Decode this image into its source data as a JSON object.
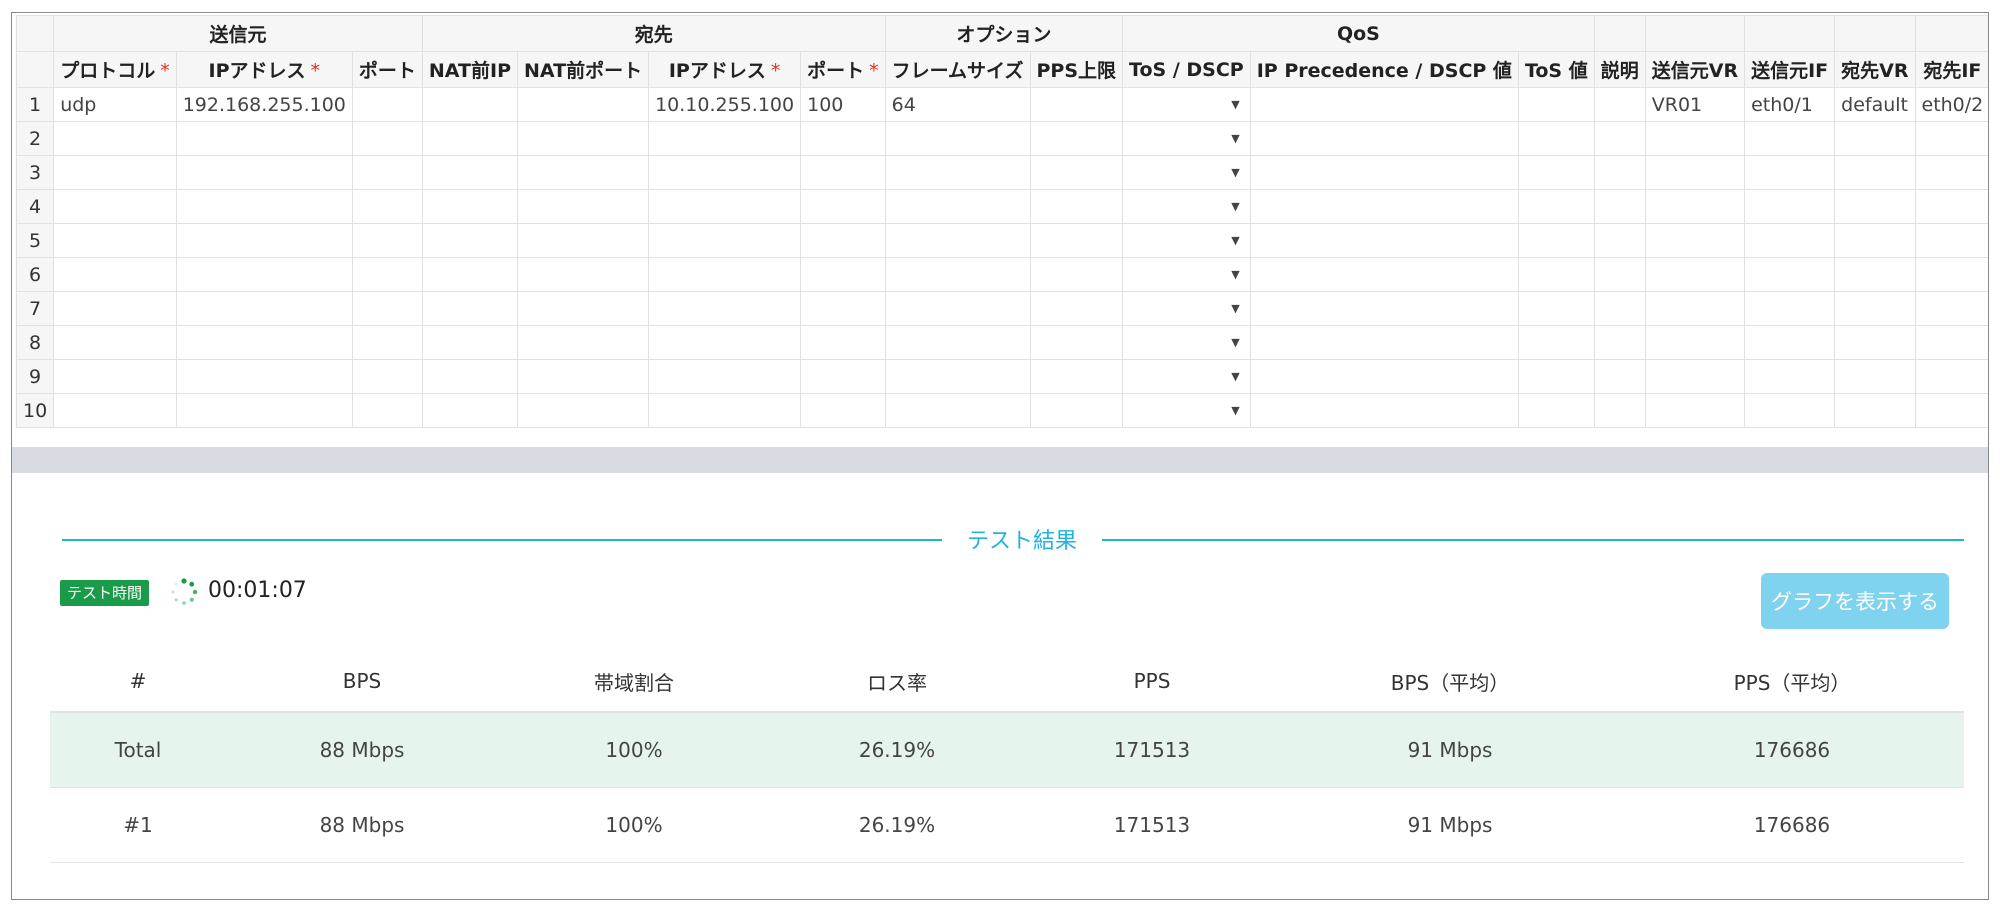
{
  "groups": {
    "source": "送信元",
    "destination": "宛先",
    "options": "オプション",
    "qos": "QoS"
  },
  "columns": [
    {
      "label": "プロトコル",
      "required": true
    },
    {
      "label": "IPアドレス",
      "required": true
    },
    {
      "label": "ポート",
      "required": false
    },
    {
      "label": "NAT前IP",
      "required": false
    },
    {
      "label": "NAT前ポート",
      "required": false
    },
    {
      "label": "IPアドレス",
      "required": true
    },
    {
      "label": "ポート",
      "required": true
    },
    {
      "label": "フレームサイズ",
      "required": false
    },
    {
      "label": "PPS上限",
      "required": false
    },
    {
      "label": "ToS / DSCP",
      "required": false
    },
    {
      "label": "IP Precedence / DSCP 値",
      "required": false
    },
    {
      "label": "ToS 値",
      "required": false
    },
    {
      "label": "説明",
      "required": false
    },
    {
      "label": "送信元VR",
      "required": false
    },
    {
      "label": "送信元IF",
      "required": false
    },
    {
      "label": "宛先VR",
      "required": false
    },
    {
      "label": "宛先IF",
      "required": false
    }
  ],
  "rows": [
    {
      "num": "1",
      "cells": [
        "udp",
        "192.168.255.100",
        "",
        "",
        "",
        "10.10.255.100",
        "100",
        "64",
        "",
        "",
        "",
        "",
        "",
        "VR01",
        "eth0/1",
        "default",
        "eth0/2"
      ]
    },
    {
      "num": "2",
      "cells": [
        "",
        "",
        "",
        "",
        "",
        "",
        "",
        "",
        "",
        "",
        "",
        "",
        "",
        "",
        "",
        "",
        ""
      ]
    },
    {
      "num": "3",
      "cells": [
        "",
        "",
        "",
        "",
        "",
        "",
        "",
        "",
        "",
        "",
        "",
        "",
        "",
        "",
        "",
        "",
        ""
      ]
    },
    {
      "num": "4",
      "cells": [
        "",
        "",
        "",
        "",
        "",
        "",
        "",
        "",
        "",
        "",
        "",
        "",
        "",
        "",
        "",
        "",
        ""
      ]
    },
    {
      "num": "5",
      "cells": [
        "",
        "",
        "",
        "",
        "",
        "",
        "",
        "",
        "",
        "",
        "",
        "",
        "",
        "",
        "",
        "",
        ""
      ]
    },
    {
      "num": "6",
      "cells": [
        "",
        "",
        "",
        "",
        "",
        "",
        "",
        "",
        "",
        "",
        "",
        "",
        "",
        "",
        "",
        "",
        ""
      ]
    },
    {
      "num": "7",
      "cells": [
        "",
        "",
        "",
        "",
        "",
        "",
        "",
        "",
        "",
        "",
        "",
        "",
        "",
        "",
        "",
        "",
        ""
      ]
    },
    {
      "num": "8",
      "cells": [
        "",
        "",
        "",
        "",
        "",
        "",
        "",
        "",
        "",
        "",
        "",
        "",
        "",
        "",
        "",
        "",
        ""
      ]
    },
    {
      "num": "9",
      "cells": [
        "",
        "",
        "",
        "",
        "",
        "",
        "",
        "",
        "",
        "",
        "",
        "",
        "",
        "",
        "",
        "",
        ""
      ]
    },
    {
      "num": "10",
      "cells": [
        "",
        "",
        "",
        "",
        "",
        "",
        "",
        "",
        "",
        "",
        "",
        "",
        "",
        "",
        "",
        "",
        ""
      ]
    }
  ],
  "results": {
    "title": "テスト結果",
    "badge": "テスト時間",
    "elapsed": "00:01:07",
    "graph_button": "グラフを表示する",
    "headers": [
      "#",
      "BPS",
      "帯域割合",
      "ロス率",
      "PPS",
      "BPS（平均）",
      "PPS（平均）"
    ],
    "rows": [
      {
        "cells": [
          "Total",
          "88 Mbps",
          "100%",
          "26.19%",
          "171513",
          "91 Mbps",
          "176686"
        ],
        "highlight": true
      },
      {
        "cells": [
          "#1",
          "88 Mbps",
          "100%",
          "26.19%",
          "171513",
          "91 Mbps",
          "176686"
        ],
        "highlight": false
      }
    ]
  },
  "colors": {
    "accent": "#1fb4e0",
    "badge": "#1a9b4a",
    "required": "#e0301e",
    "total_row": "#e5f5ee",
    "button": "#7fd3ee"
  }
}
